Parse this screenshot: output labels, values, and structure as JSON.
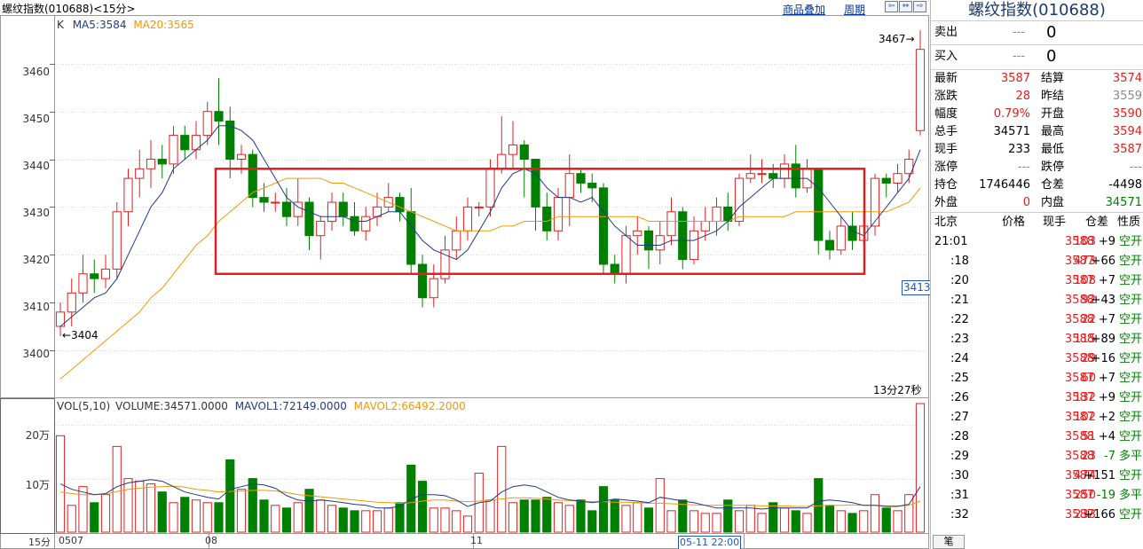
{
  "window": {
    "title": "螺纹指数(010688)<15分>",
    "links": {
      "overlay": "商品叠加",
      "period": "周期"
    },
    "nav_buttons": [
      "⇦",
      "⇔",
      "⇨"
    ]
  },
  "chart_legend": {
    "k_label": "K",
    "ma5": "MA5:3584",
    "ma20": "MA20:3565",
    "vol_label": "VOL(5,10)",
    "volume": "VOLUME:34571.0000",
    "mavol1": "MAVOL1:72149.0000",
    "mavol2": "MAVOL2:66492.2000"
  },
  "colors": {
    "up": "#e02020",
    "down": "#008000",
    "ma5": "#1e3a8a",
    "ma20": "#f39800",
    "box": "#e02020",
    "grid": "#d6d6d6"
  },
  "price_axis_labels": [
    "3460",
    "3450",
    "3440",
    "3430",
    "3420",
    "3410",
    "3400"
  ],
  "volume_axis_labels": [
    "20万",
    "10万"
  ],
  "x_axis_labels": [
    "0507",
    "08",
    "11"
  ],
  "corner_period": "15分",
  "annotations": {
    "high": "3467",
    "low": "3404",
    "timer": "13分27秒",
    "current_price_tag": "3413",
    "crosshair_time": "05-11 22:00"
  },
  "chart_data": {
    "type": "candlestick",
    "ylim": [
      3395,
      3470
    ],
    "vol_ylim": [
      0,
      250000
    ],
    "highlight_box": {
      "y_range": [
        3416,
        3438
      ]
    },
    "candles": [
      [
        3405,
        3408,
        3403,
        3410
      ],
      [
        3408,
        3412,
        3405,
        3415
      ],
      [
        3412,
        3416,
        3410,
        3420
      ],
      [
        3416,
        3415,
        3412,
        3419
      ],
      [
        3415,
        3417,
        3413,
        3420
      ],
      [
        3417,
        3429,
        3415,
        3431
      ],
      [
        3429,
        3436,
        3426,
        3438
      ],
      [
        3436,
        3438,
        3432,
        3442
      ],
      [
        3438,
        3440,
        3434,
        3444
      ],
      [
        3440,
        3439,
        3436,
        3443
      ],
      [
        3439,
        3445,
        3437,
        3447
      ],
      [
        3445,
        3442,
        3440,
        3447
      ],
      [
        3442,
        3445,
        3440,
        3448
      ],
      [
        3445,
        3450,
        3443,
        3452
      ],
      [
        3450,
        3448,
        3443,
        3457
      ],
      [
        3448,
        3440,
        3436,
        3451
      ],
      [
        3440,
        3441,
        3437,
        3443
      ],
      [
        3441,
        3432,
        3430,
        3442
      ],
      [
        3432,
        3431,
        3429,
        3435
      ],
      [
        3431,
        3431,
        3429,
        3433
      ],
      [
        3431,
        3428,
        3426,
        3434
      ],
      [
        3428,
        3431,
        3426,
        3436
      ],
      [
        3431,
        3424,
        3421,
        3432
      ],
      [
        3424,
        3427,
        3419,
        3428
      ],
      [
        3427,
        3431,
        3425,
        3433
      ],
      [
        3431,
        3428,
        3426,
        3433
      ],
      [
        3428,
        3425,
        3424,
        3431
      ],
      [
        3425,
        3428,
        3423,
        3430
      ],
      [
        3428,
        3430,
        3426,
        3433
      ],
      [
        3430,
        3432,
        3429,
        3435
      ],
      [
        3432,
        3429,
        3427,
        3433
      ],
      [
        3429,
        3418,
        3416,
        3434
      ],
      [
        3418,
        3411,
        3409,
        3420
      ],
      [
        3411,
        3415,
        3409,
        3418
      ],
      [
        3415,
        3421,
        3414,
        3424
      ],
      [
        3421,
        3425,
        3419,
        3428
      ],
      [
        3425,
        3430,
        3423,
        3432
      ],
      [
        3430,
        3430,
        3428,
        3431
      ],
      [
        3430,
        3438,
        3428,
        3440
      ],
      [
        3438,
        3441,
        3437,
        3449
      ],
      [
        3441,
        3443,
        3438,
        3448
      ],
      [
        3443,
        3440,
        3432,
        3444
      ],
      [
        3440,
        3430,
        3425,
        3440
      ],
      [
        3430,
        3425,
        3423,
        3433
      ],
      [
        3425,
        3432,
        3423,
        3434
      ],
      [
        3432,
        3437,
        3426,
        3441
      ],
      [
        3437,
        3435,
        3433,
        3438
      ],
      [
        3435,
        3434,
        3431,
        3437
      ],
      [
        3434,
        3418,
        3416,
        3435
      ],
      [
        3418,
        3416,
        3414,
        3420
      ],
      [
        3416,
        3424,
        3414,
        3426
      ],
      [
        3424,
        3425,
        3420,
        3428
      ],
      [
        3425,
        3421,
        3417,
        3426
      ],
      [
        3421,
        3424,
        3418,
        3427
      ],
      [
        3424,
        3429,
        3422,
        3432
      ],
      [
        3429,
        3419,
        3417,
        3430
      ],
      [
        3419,
        3425,
        3418,
        3428
      ],
      [
        3425,
        3427,
        3423,
        3430
      ],
      [
        3427,
        3430,
        3424,
        3432
      ],
      [
        3430,
        3427,
        3425,
        3433
      ],
      [
        3427,
        3436,
        3426,
        3437
      ],
      [
        3436,
        3437,
        3435,
        3441
      ],
      [
        3437,
        3437,
        3435,
        3440
      ],
      [
        3437,
        3436,
        3434,
        3439
      ],
      [
        3436,
        3439,
        3434,
        3441
      ],
      [
        3439,
        3434,
        3432,
        3443
      ],
      [
        3434,
        3438,
        3433,
        3440
      ],
      [
        3438,
        3423,
        3420,
        3438
      ],
      [
        3423,
        3421,
        3419,
        3425
      ],
      [
        3421,
        3426,
        3420,
        3428
      ],
      [
        3426,
        3423,
        3421,
        3429
      ],
      [
        3423,
        3426,
        3422,
        3429
      ],
      [
        3426,
        3436,
        3424,
        3437
      ],
      [
        3436,
        3435,
        3432,
        3437
      ],
      [
        3435,
        3437,
        3433,
        3439
      ],
      [
        3437,
        3440,
        3435,
        3442
      ],
      [
        3446,
        3463,
        3445,
        3467
      ]
    ],
    "ma5": [
      3405,
      3407,
      3409,
      3411,
      3412,
      3415,
      3420,
      3425,
      3430,
      3433,
      3438,
      3440,
      3442,
      3444,
      3447,
      3447,
      3446,
      3444,
      3440,
      3436,
      3432,
      3430,
      3429,
      3428,
      3428,
      3428,
      3427,
      3427,
      3428,
      3429,
      3429,
      3426,
      3423,
      3421,
      3420,
      3419,
      3421,
      3425,
      3429,
      3434,
      3437,
      3438,
      3437,
      3434,
      3432,
      3432,
      3431,
      3432,
      3429,
      3426,
      3424,
      3422,
      3422,
      3422,
      3423,
      3423,
      3423,
      3424,
      3425,
      3427,
      3430,
      3432,
      3434,
      3436,
      3436,
      3436,
      3436,
      3434,
      3431,
      3428,
      3425,
      3424,
      3427,
      3430,
      3433,
      3436,
      3442
    ],
    "ma20": [
      3394,
      3396,
      3398,
      3400,
      3402,
      3404,
      3406,
      3408,
      3411,
      3413,
      3416,
      3419,
      3422,
      3424,
      3427,
      3429,
      3431,
      3433,
      3434,
      3435,
      3436,
      3436,
      3436,
      3436,
      3435,
      3435,
      3434,
      3433,
      3432,
      3431,
      3430,
      3429,
      3428,
      3427,
      3426,
      3425,
      3425,
      3425,
      3425,
      3426,
      3426,
      3427,
      3427,
      3427,
      3428,
      3428,
      3428,
      3428,
      3428,
      3428,
      3428,
      3428,
      3427,
      3427,
      3427,
      3427,
      3427,
      3427,
      3427,
      3427,
      3428,
      3428,
      3428,
      3428,
      3428,
      3429,
      3429,
      3429,
      3429,
      3429,
      3429,
      3429,
      3429,
      3429,
      3430,
      3431,
      3434
    ],
    "volume": [
      180000,
      50000,
      85000,
      55000,
      70000,
      160000,
      100000,
      95000,
      90000,
      75000,
      55000,
      65000,
      60000,
      55000,
      55000,
      135000,
      80000,
      100000,
      60000,
      50000,
      45000,
      55000,
      80000,
      60000,
      50000,
      45000,
      40000,
      40000,
      40000,
      45000,
      55000,
      125000,
      95000,
      45000,
      45000,
      40000,
      30000,
      110000,
      60000,
      160000,
      55000,
      60000,
      60000,
      65000,
      55000,
      50000,
      60000,
      40000,
      85000,
      60000,
      50000,
      55000,
      45000,
      100000,
      40000,
      60000,
      40000,
      35000,
      35000,
      60000,
      40000,
      50000,
      35000,
      55000,
      45000,
      40000,
      35000,
      100000,
      50000,
      40000,
      35000,
      40000,
      70000,
      45000,
      40000,
      70000,
      240000
    ],
    "mavol1": [
      90000,
      80000,
      75000,
      70000,
      72000,
      85000,
      92000,
      95000,
      98000,
      95000,
      85000,
      75000,
      70000,
      65000,
      62000,
      80000,
      85000,
      90000,
      88000,
      82000,
      68000,
      60000,
      58000,
      60000,
      58000,
      55000,
      52000,
      50000,
      45000,
      45000,
      48000,
      62000,
      70000,
      70000,
      68000,
      60000,
      48000,
      55000,
      58000,
      75000,
      85000,
      88000,
      85000,
      75000,
      65000,
      60000,
      58000,
      55000,
      58000,
      62000,
      60000,
      58000,
      55000,
      65000,
      62000,
      58000,
      55000,
      50000,
      45000,
      45000,
      45000,
      45000,
      43000,
      45000,
      45000,
      45000,
      45000,
      58000,
      60000,
      58000,
      55000,
      50000,
      50000,
      48000,
      48000,
      52000,
      85000
    ],
    "mavol2": [
      75000,
      72000,
      70000,
      70000,
      71000,
      76000,
      80000,
      82000,
      84000,
      85000,
      86000,
      84000,
      80000,
      78000,
      75000,
      76000,
      77000,
      78000,
      78000,
      77000,
      74000,
      70000,
      68000,
      66000,
      64000,
      62000,
      60000,
      58000,
      56000,
      55000,
      54000,
      55000,
      58000,
      60000,
      60000,
      58000,
      57000,
      58000,
      60000,
      62000,
      64000,
      64000,
      63000,
      62000,
      60000,
      59000,
      58000,
      57000,
      57000,
      56000,
      56000,
      55000,
      54000,
      54000,
      53000,
      52000,
      51000,
      50000,
      50000,
      50000,
      50000,
      50000,
      49000,
      49000,
      49000,
      48000,
      48000,
      49000,
      50000,
      50000,
      51000,
      50000,
      50000,
      49000,
      49000,
      50000,
      58000
    ]
  },
  "quote_panel": {
    "title": "螺纹指数(010688)",
    "sell": {
      "label": "卖出",
      "price": "---",
      "vol": "0"
    },
    "buy": {
      "label": "买入",
      "price": "---",
      "vol": "0"
    },
    "stats": [
      {
        "l1": "最新",
        "v1": "3587",
        "c1": "red",
        "l2": "结算",
        "v2": "3574",
        "c2": "red"
      },
      {
        "l1": "涨跌",
        "v1": "28",
        "c1": "red",
        "l2": "昨结",
        "v2": "3559",
        "c2": "gray"
      },
      {
        "l1": "幅度",
        "v1": "0.79%",
        "c1": "red",
        "l2": "开盘",
        "v2": "3590",
        "c2": "red"
      },
      {
        "l1": "总手",
        "v1": "34571",
        "c1": "black",
        "l2": "最高",
        "v2": "3594",
        "c2": "red"
      },
      {
        "l1": "现手",
        "v1": "233",
        "c1": "black",
        "l2": "最低",
        "v2": "3587",
        "c2": "red"
      },
      {
        "l1": "涨停",
        "v1": "---",
        "c1": "gray",
        "l2": "跌停",
        "v2": "---",
        "c2": "gray"
      },
      {
        "l1": "持仓",
        "v1": "1746446",
        "c1": "black",
        "l2": "仓差",
        "v2": "-4498",
        "c2": "black"
      },
      {
        "l1": "外盘",
        "v1": "0",
        "c1": "red",
        "l2": "内盘",
        "v2": "34571",
        "c2": "green"
      }
    ],
    "tick_header": {
      "time": "北京",
      "price": "价格",
      "vol": "现手",
      "oi": "仓差",
      "nature": "性质"
    },
    "ticks": [
      {
        "time": "21:01",
        "price": "3588",
        "vol": "103",
        "oi": "+9",
        "nature": "空开"
      },
      {
        "time": ":18",
        "price": "3587",
        "vol": "473",
        "oi": "+66",
        "nature": "空开"
      },
      {
        "time": ":20",
        "price": "3587",
        "vol": "108",
        "oi": "+7",
        "nature": "空开"
      },
      {
        "time": ":21",
        "price": "3588",
        "vol": "92",
        "oi": "+43",
        "nature": "空开"
      },
      {
        "time": ":22",
        "price": "3588",
        "vol": "22",
        "oi": "+7",
        "nature": "空开"
      },
      {
        "time": ":23",
        "price": "3588",
        "vol": "115",
        "oi": "+89",
        "nature": "空开"
      },
      {
        "time": ":24",
        "price": "3588",
        "vol": "29",
        "oi": "+16",
        "nature": "空开"
      },
      {
        "time": ":25",
        "price": "3587",
        "vol": "60",
        "oi": "+7",
        "nature": "空开"
      },
      {
        "time": ":26",
        "price": "3587",
        "vol": "132",
        "oi": "+9",
        "nature": "空开"
      },
      {
        "time": ":27",
        "price": "3587",
        "vol": "102",
        "oi": "+2",
        "nature": "空开"
      },
      {
        "time": ":28",
        "price": "3588",
        "vol": "51",
        "oi": "+4",
        "nature": "空开"
      },
      {
        "time": ":29",
        "price": "3588",
        "vol": "23",
        "oi": "-7",
        "nature": "多平"
      },
      {
        "time": ":30",
        "price": "3587",
        "vol": "474",
        "oi": "+151",
        "nature": "空开"
      },
      {
        "time": ":31",
        "price": "3587",
        "vol": "250",
        "oi": "-19",
        "nature": "多平"
      },
      {
        "time": ":32",
        "price": "3587",
        "vol": "233",
        "oi": "+166",
        "nature": "空开"
      }
    ],
    "bottom_tab": "笔"
  }
}
